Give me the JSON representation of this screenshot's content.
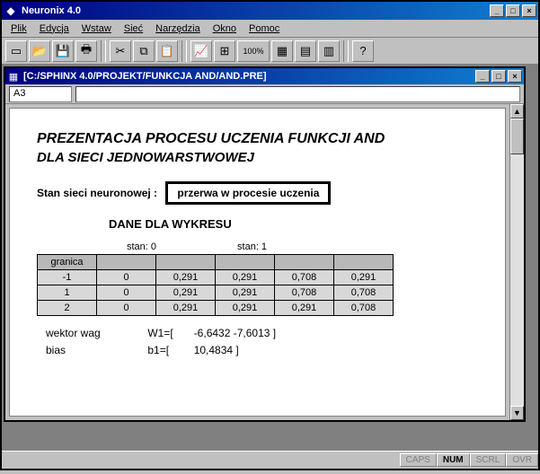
{
  "app": {
    "title": "Neuronix 4.0",
    "menu": [
      "Plik",
      "Edycja",
      "Wstaw",
      "Sieć",
      "Narzędzia",
      "Okno",
      "Pomoc"
    ]
  },
  "toolbar": {
    "icons": [
      "new",
      "open",
      "save",
      "print",
      "cut",
      "copy",
      "paste",
      "chart",
      "net",
      "100",
      "grid",
      "tool1",
      "tool2",
      "help"
    ]
  },
  "doc": {
    "title": "[C:/SPHINX 4.0/PROJEKT/FUNKCJA AND/AND.PRE]",
    "cellref": "A3"
  },
  "page": {
    "heading1": "PREZENTACJA PROCESU UCZENIA FUNKCJI AND",
    "heading2": "DLA SIECI JEDNOWARSTWOWEJ",
    "status_label": "Stan sieci neuronowej :",
    "status_value": "przerwa w procesie uczenia",
    "subheading": "DANE DLA WYKRESU",
    "col_labels": [
      "stan: 0",
      "stan: 1"
    ],
    "table": {
      "headers": [
        "granica",
        "",
        "",
        "",
        "",
        ""
      ],
      "rows": [
        [
          "-1",
          "0",
          "0,291",
          "0,291",
          "0,708",
          "0,291"
        ],
        [
          "1",
          "0",
          "0,291",
          "0,291",
          "0,708",
          "0,708"
        ],
        [
          "2",
          "0",
          "0,291",
          "0,291",
          "0,291",
          "0,708"
        ]
      ]
    },
    "vectors": {
      "w_label": "wektor wag",
      "w_name": "W1=[",
      "w_values": "-6,6432    -7,6013  ]",
      "b_label": "bias",
      "b_name": "b1=[",
      "b_values": "10,4834  ]"
    }
  },
  "statusbar": {
    "panes": [
      "CAPS",
      "NUM",
      "SCRL",
      "OVR"
    ],
    "active": 1
  }
}
